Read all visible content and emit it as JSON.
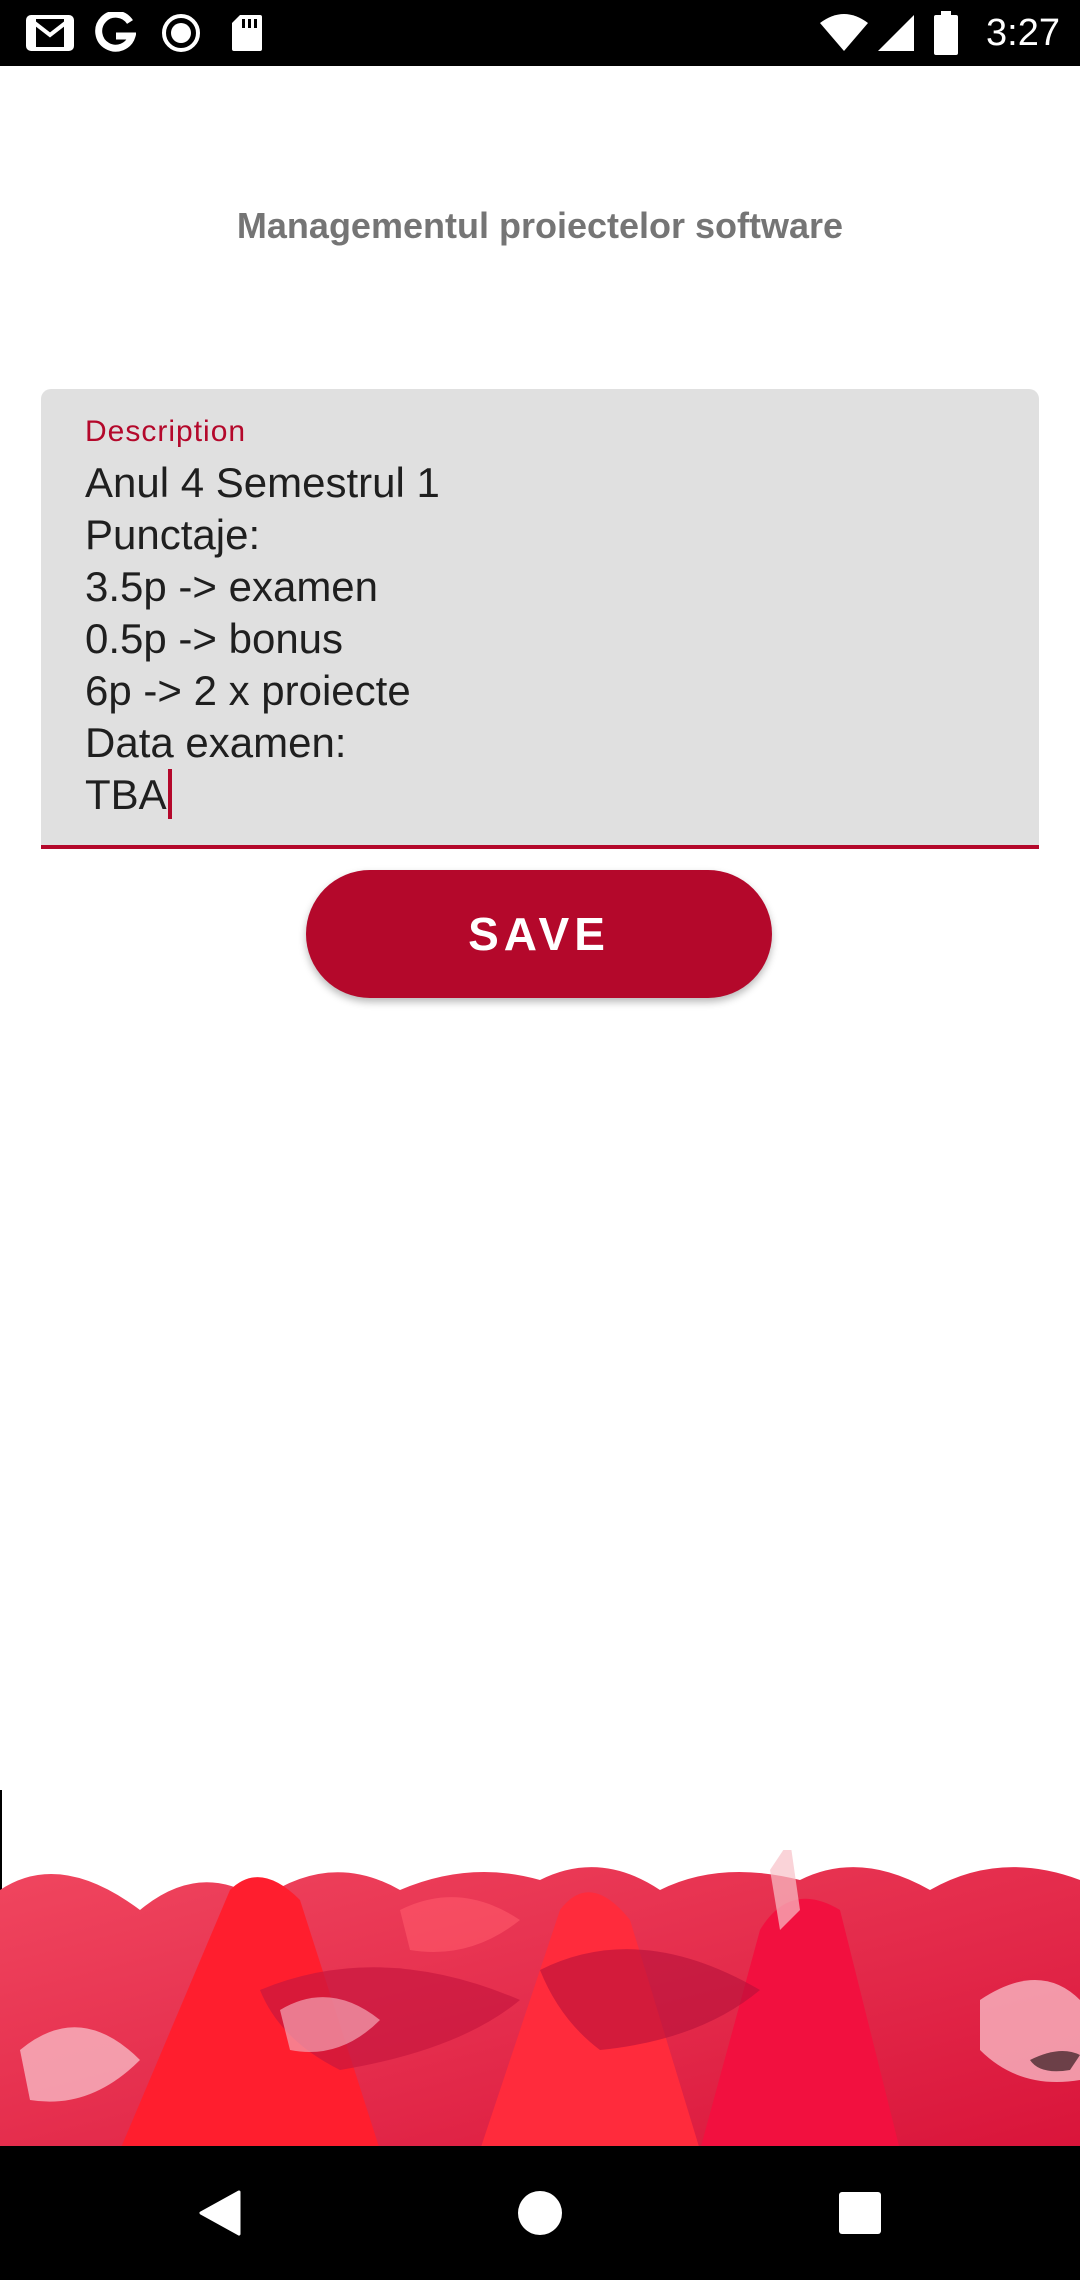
{
  "status_bar": {
    "time": "3:27",
    "left_icons": [
      "gmail-icon",
      "google-icon",
      "record-icon",
      "sd-card-icon"
    ],
    "right_icons": [
      "wifi-icon",
      "signal-icon",
      "battery-icon"
    ]
  },
  "page": {
    "title": "Managementul proiectelor software"
  },
  "description_field": {
    "label": "Description",
    "lines": [
      "Anul 4 Semestrul 1",
      "Punctaje:",
      "3.5p -> examen",
      "0.5p -> bonus",
      "6p -> 2 x proiecte",
      "Data examen:",
      "TBA"
    ]
  },
  "save_button": {
    "label": "SAVE"
  },
  "nav_bar": {
    "icons": [
      "back-icon",
      "home-icon",
      "recents-icon"
    ]
  },
  "colors": {
    "accent": "#b4082b",
    "field_background": "#e0e0e0",
    "title_text": "#757575",
    "bar_background": "#000000"
  }
}
